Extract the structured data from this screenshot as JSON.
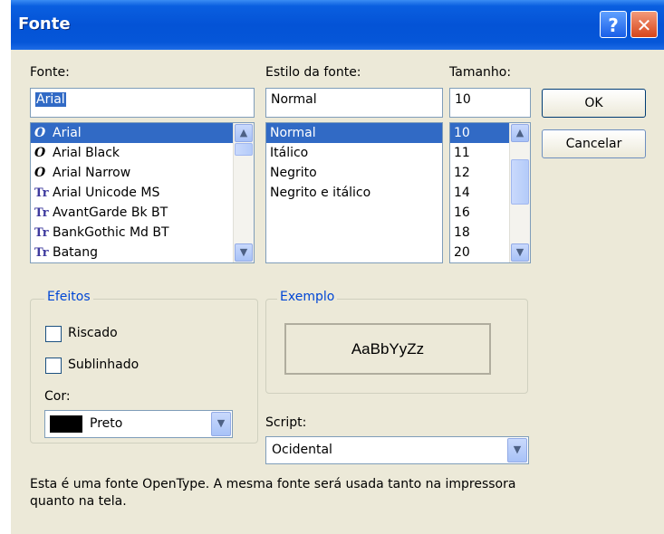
{
  "window": {
    "title": "Fonte",
    "help_label": "?",
    "close_label": "✕"
  },
  "font": {
    "label": "Fonte:",
    "value": "Arial",
    "items": [
      {
        "name": "Arial",
        "icon": "opentype-icon",
        "glyph": "O",
        "selected": true
      },
      {
        "name": "Arial Black",
        "icon": "opentype-icon",
        "glyph": "O"
      },
      {
        "name": "Arial Narrow",
        "icon": "opentype-icon",
        "glyph": "O"
      },
      {
        "name": "Arial Unicode MS",
        "icon": "truetype-icon",
        "glyph": "Tr"
      },
      {
        "name": "AvantGarde Bk BT",
        "icon": "truetype-icon",
        "glyph": "Tr"
      },
      {
        "name": "BankGothic Md BT",
        "icon": "truetype-icon",
        "glyph": "Tr"
      },
      {
        "name": "Batang",
        "icon": "truetype-icon",
        "glyph": "Tr"
      }
    ]
  },
  "style": {
    "label": "Estilo da fonte:",
    "value": "Normal",
    "items": [
      "Normal",
      "Itálico",
      "Negrito",
      "Negrito e itálico"
    ]
  },
  "size": {
    "label": "Tamanho:",
    "value": "10",
    "items": [
      "10",
      "11",
      "12",
      "14",
      "16",
      "18",
      "20"
    ]
  },
  "buttons": {
    "ok": "OK",
    "cancel": "Cancelar"
  },
  "effects": {
    "legend": "Efeitos",
    "strikeout": "Riscado",
    "underline": "Sublinhado",
    "color_label": "Cor:",
    "color_value": "Preto",
    "color_swatch": "#000000"
  },
  "sample": {
    "legend": "Exemplo",
    "text": "AaBbYyZz"
  },
  "script": {
    "label": "Script:",
    "value": "Ocidental"
  },
  "description": "Esta é uma fonte OpenType. A mesma fonte será usada tanto na impressora quanto na tela.",
  "colors": {
    "accent": "#0046d5",
    "selection": "#316ac5",
    "titlebar": "#0453d6",
    "face": "#ece9d8"
  }
}
